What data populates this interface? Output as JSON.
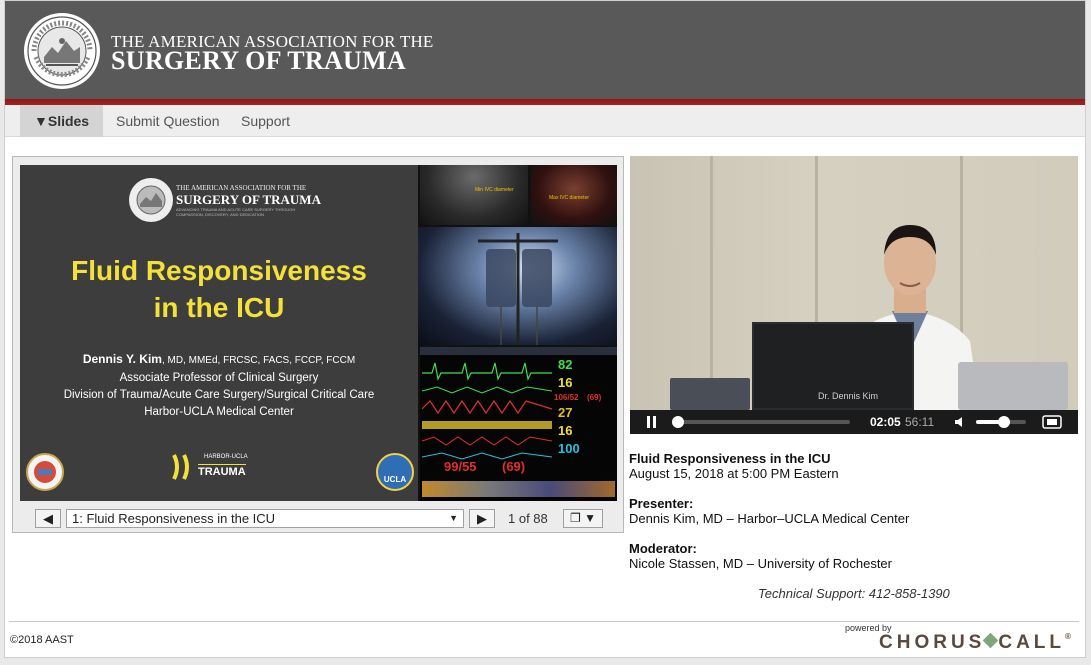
{
  "header": {
    "org_line1": "THE AMERICAN ASSOCIATION FOR THE",
    "org_line2": "SURGERY OF TRAUMA",
    "seal_text_top": "AMERICAN ASSOCIATION",
    "seal_text_bottom": "FOR THE SURGERY OF TRAUMA"
  },
  "nav": {
    "tabs": [
      {
        "label": "▼Slides",
        "active": true
      },
      {
        "label": "Submit Question",
        "active": false
      },
      {
        "label": "Support",
        "active": false
      }
    ]
  },
  "slide": {
    "org_line1": "THE AMERICAN ASSOCIATION FOR THE",
    "org_line2": "SURGERY OF TRAUMA",
    "org_tagline1": "ADVANCING TRAUMA AND ACUTE CARE SURGERY THROUGH",
    "org_tagline2": "COMPASSION, DISCOVERY, AND DEDICATION",
    "title_line1": "Fluid Responsiveness",
    "title_line2": "in the ICU",
    "presenter_name": "Dennis Y. Kim",
    "presenter_credentials": ", MD, MMEd, FRCSC, FACS, FCCP, FCCM",
    "line1": "Associate Professor of Clinical Surgery",
    "line2": "Division of Trauma/Acute Care Surgery/Surgical Critical Care",
    "line3": "Harbor-UCLA Medical Center",
    "logo_small": "HARBOR-UCLA",
    "logo_main": "TRAUMA",
    "ucla_badge": "UCLA",
    "us_label_min": "Min IVC diameter",
    "us_label_max": "Max IVC diameter",
    "monitor_values": [
      "82",
      "16",
      "106/52",
      "(69)",
      "27",
      "16",
      "100",
      "99/55",
      "(69)"
    ]
  },
  "slide_controls": {
    "prev": "◀",
    "selected": "1: Fluid Responsiveness in the ICU",
    "dropdown_arrow": "▼",
    "next": "▶",
    "page_info": "1 of 88",
    "view_menu": "❐ ▼"
  },
  "video": {
    "nameplate": "Dr. Dennis Kim",
    "current_time": "02:05",
    "duration": "56:11",
    "progress": 0.02,
    "volume": 0.55
  },
  "info": {
    "title": "Fluid Responsiveness in the ICU",
    "datetime": "August 15, 2018 at 5:00 PM Eastern",
    "presenter_label": "Presenter:",
    "presenter": "Dennis Kim, MD – Harbor–UCLA Medical Center",
    "moderator_label": "Moderator:",
    "moderator": "Nicole Stassen, MD – University of Rochester",
    "support": "Technical Support: 412-858-1390"
  },
  "footer": {
    "copyright": "©2018 AAST",
    "powered_by": "powered by",
    "brand_left": "CHORUS",
    "brand_right": "CALL",
    "registered": "®"
  },
  "colors": {
    "header_bg": "#5a5959",
    "accent_red": "#a52222",
    "slide_title_yellow": "#f3e03a"
  }
}
